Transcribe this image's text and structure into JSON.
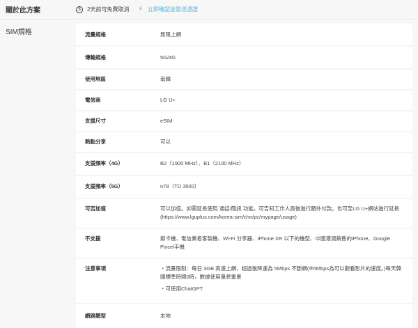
{
  "header": {
    "title": "關於此方案",
    "cancel_text": "2天前可免費取消",
    "confirm_text": "立即確認並發送憑證"
  },
  "section": {
    "title": "SIM規格"
  },
  "specs": [
    {
      "label": "流量規格",
      "value": [
        "無限上網"
      ]
    },
    {
      "label": "傳輸規格",
      "value": [
        "5G/4G"
      ]
    },
    {
      "label": "使用地區",
      "value": [
        "南韓"
      ]
    },
    {
      "label": "電信商",
      "value": [
        "LG U+"
      ]
    },
    {
      "label": "支援尺寸",
      "value": [
        "eSIM"
      ]
    },
    {
      "label": "熱點分享",
      "value": [
        "可以"
      ]
    },
    {
      "label": "支援頻率（4G）",
      "value": [
        "B2（1900 MHz）、B1（2100 MHz）"
      ]
    },
    {
      "label": "支援頻率（5G）",
      "value": [
        "n78（TD 3500）"
      ]
    },
    {
      "label": "可否加值",
      "value": [
        "可以加值。如需延長使用 通話/簡訊 功能，可告知工作人員後進行額外付款。也可至LG U+網站進行延長(https://www.lguplus.com/korea-sim/chn/pc/mypage/usage)"
      ]
    },
    {
      "label": "不支援",
      "value": [
        "鎖卡機、電信業者客製機、Wi-Fi 分享器、iPhone XR 以下的機型、中國港澳銷售的iPhone、Google Pixcel手機"
      ]
    },
    {
      "label": "注意事項",
      "value": [
        "・流量限制：每日 3GB 高速上網，超過後降速為 5Mbps 不斷網(※5Mbps為可以觀看影片的速度。)每天韓國標準時間0時，數據使用量將重置",
        "・可使用ChatGPT"
      ]
    },
    {
      "label": "網路類型",
      "value": [
        "本地"
      ]
    }
  ]
}
